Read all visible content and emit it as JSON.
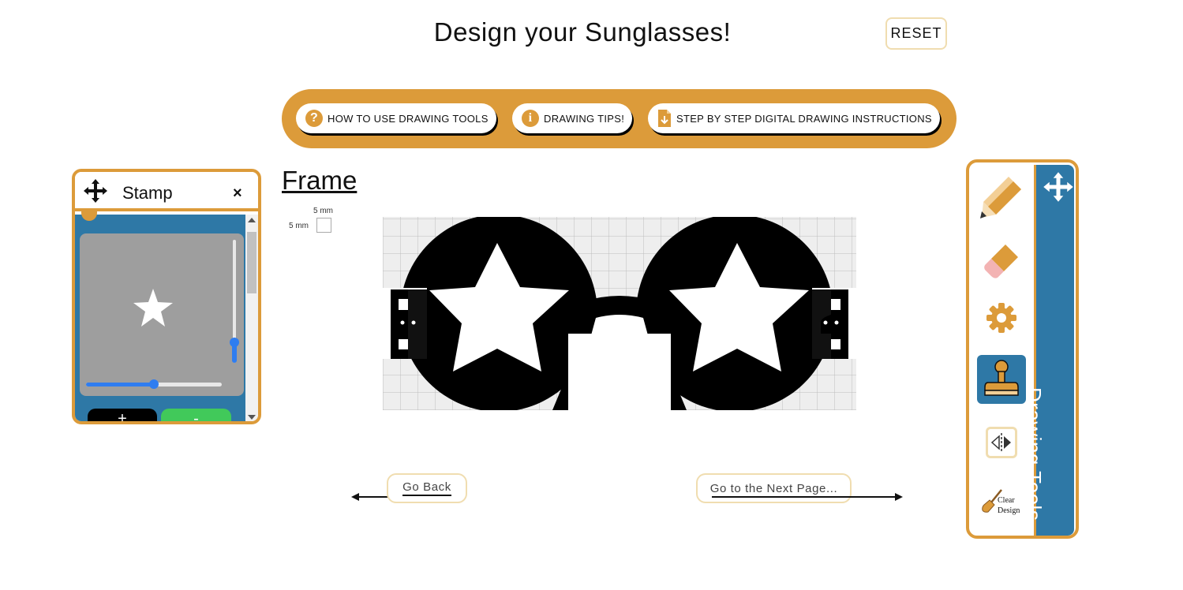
{
  "page": {
    "title": "Design your Sunglasses!",
    "reset_label": "RESET"
  },
  "help_bar": {
    "buttons": [
      {
        "label": "HOW TO USE DRAWING TOOLS",
        "icon": "question-circle-icon"
      },
      {
        "label": "DRAWING TIPS!",
        "icon": "info-circle-icon"
      },
      {
        "label": "STEP BY STEP DIGITAL DRAWING INSTRUCTIONS",
        "icon": "download-document-icon"
      }
    ]
  },
  "stamp_panel": {
    "title": "Stamp",
    "close_label": "×",
    "plus_label": "+",
    "minus_label": "-",
    "stamp_shape": "star-icon",
    "size_slider_value": 0.5,
    "vertical_slider_value": 0.2
  },
  "frame": {
    "heading": "Frame",
    "scale_width_label": "5 mm",
    "scale_height_label": "5 mm"
  },
  "navigation": {
    "back_label": "Go Back",
    "next_label": "Go to the Next Page..."
  },
  "tools_panel": {
    "label": "Drawing Tools",
    "tools": [
      "pencil-icon",
      "eraser-icon",
      "gear-icon",
      "stamp-icon",
      "mirror-icon",
      "broom-icon"
    ],
    "active_tool": "stamp-icon",
    "clear_label_line1": "Clear",
    "clear_label_line2": "Design"
  },
  "colors": {
    "accent": "#dc9b3a",
    "panel_blue": "#2e78a6",
    "frame_black": "#000000",
    "grid_bg": "#eeeeee"
  }
}
